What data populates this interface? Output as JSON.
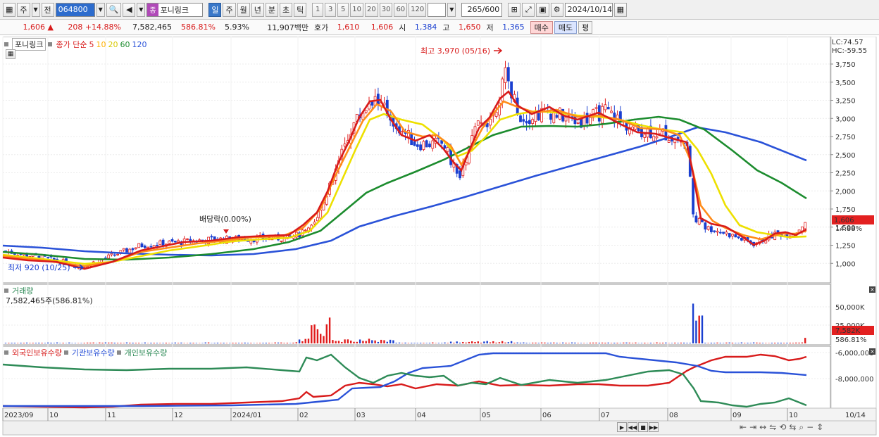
{
  "toolbar": {
    "market_label": "주",
    "prev_label": "전",
    "stock_code": "064800",
    "stock_tag": "종",
    "stock_name": "포니링크",
    "periods": [
      "일",
      "주",
      "월",
      "년",
      "분",
      "초",
      "틱"
    ],
    "active_period": "일",
    "intervals": [
      "1",
      "3",
      "5",
      "10",
      "20",
      "30",
      "60",
      "120"
    ],
    "view_count": "265",
    "view_total": "/600",
    "date": "2024/10/14"
  },
  "quote": {
    "price": "1,606",
    "change_arrow": "▲",
    "change": "208",
    "change_pct": "+14.88%",
    "volume": "7,582,465",
    "volume_ratio": "586.81%",
    "turnover": "5.93%",
    "amount": "11,907백만",
    "hoga_label": "호가",
    "ask": "1,610",
    "bid": "1,606",
    "open_label": "시",
    "open": "1,384",
    "high_label": "고",
    "high": "1,650",
    "low_label": "저",
    "low": "1,365",
    "buy_label": "매수",
    "sell_label": "매도",
    "eval_label": "평"
  },
  "price_panel": {
    "legend": {
      "name": "포니링크",
      "title": "종가 단순",
      "ma": [
        {
          "period": "5",
          "color": "#d81b1b"
        },
        {
          "period": "10",
          "color": "#ff8c1a"
        },
        {
          "period": "20",
          "color": "#e8d800"
        },
        {
          "period": "60",
          "color": "#1c8c2e"
        },
        {
          "period": "120",
          "color": "#2a52d8"
        }
      ]
    },
    "lc": "LC:74.57",
    "hc": "HC:-59.55",
    "high_annotation": "최고 3,970 (05/16)",
    "low_annotation": "최저 920 (10/25)",
    "dividend_annotation": "배당락(0.00%)",
    "current_price_badge": "1,606",
    "current_change_badge": "14.88%"
  },
  "volume_panel": {
    "title": "거래량",
    "value": "7,582,465주(586.81%)",
    "badge_value": "7,582K",
    "badge_pct": "586.81%"
  },
  "holdings_panel": {
    "legend": [
      "외국인보유수량",
      "기관보유수량",
      "개인보유수량"
    ],
    "colors": [
      "#d81b1b",
      "#2a52d8",
      "#2e8b57"
    ]
  },
  "x_axis": {
    "labels": [
      "2023/09",
      "10",
      "11",
      "12",
      "2024/01",
      "02",
      "03",
      "04",
      "05",
      "06",
      "07",
      "08",
      "09",
      "10"
    ],
    "last_date": "10/14"
  },
  "chart_data": [
    {
      "type": "candlestick",
      "title": "포니링크 종가 단순",
      "y_ticks": [
        "3,750",
        "3,500",
        "3,250",
        "3,000",
        "2,750",
        "2,500",
        "2,250",
        "2,000",
        "1,750",
        "1,500",
        "1,250",
        "1,000"
      ],
      "ylim": [
        800,
        4000
      ],
      "monthly_close": [
        {
          "x": "2023/09",
          "y": 1170
        },
        {
          "x": "10",
          "y": 960
        },
        {
          "x": "11",
          "y": 1080
        },
        {
          "x": "12",
          "y": 1280
        },
        {
          "x": "2024/01",
          "y": 1320
        },
        {
          "x": "02",
          "y": 1550
        },
        {
          "x": "03",
          "y": 3050
        },
        {
          "x": "04",
          "y": 2650
        },
        {
          "x": "05",
          "y": 3000
        },
        {
          "x": "06",
          "y": 3000
        },
        {
          "x": "07",
          "y": 2800
        },
        {
          "x": "08",
          "y": 1520
        },
        {
          "x": "09",
          "y": 1290
        },
        {
          "x": "10",
          "y": 1606
        }
      ]
    },
    {
      "type": "bar",
      "title": "거래량",
      "y_ticks": [
        "50,000K",
        "25,000K"
      ],
      "ylim": [
        0,
        70000
      ]
    },
    {
      "type": "line",
      "title": "외국인보유수량 / 기관보유수량 / 개인보유수량",
      "y_ticks": [
        "-6,000,000",
        "-8,000,000"
      ]
    }
  ]
}
